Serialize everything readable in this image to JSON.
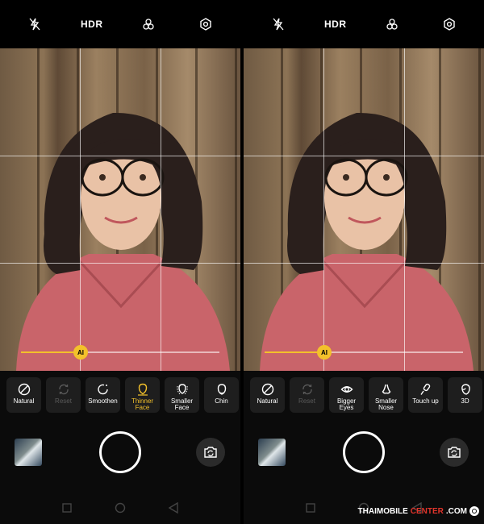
{
  "colors": {
    "accent": "#f3c12b",
    "watermark_accent": "#e0342b"
  },
  "topbar": {
    "hdr_label": "HDR",
    "icons": [
      "flash-off-icon",
      "filter-icon",
      "settings-icon"
    ]
  },
  "slider": {
    "badge": "AI",
    "level": 0.3
  },
  "left_panel": {
    "tools": [
      {
        "label": "Natural",
        "icon": "natural-icon",
        "state": "normal"
      },
      {
        "label": "Reset",
        "icon": "reset-icon",
        "state": "disabled"
      },
      {
        "label": "Smoothen",
        "icon": "smoothen-icon",
        "state": "normal"
      },
      {
        "label": "Thinner\nFace",
        "icon": "thinner-face-icon",
        "state": "active"
      },
      {
        "label": "Smaller\nFace",
        "icon": "smaller-face-icon",
        "state": "normal"
      },
      {
        "label": "Chin",
        "icon": "chin-icon",
        "state": "normal"
      }
    ]
  },
  "right_panel": {
    "tools": [
      {
        "label": "Natural",
        "icon": "natural-icon",
        "state": "normal"
      },
      {
        "label": "Reset",
        "icon": "reset-icon",
        "state": "disabled"
      },
      {
        "label": "Bigger\nEyes",
        "icon": "eye-icon",
        "state": "normal"
      },
      {
        "label": "Smaller\nNose",
        "icon": "nose-icon",
        "state": "normal"
      },
      {
        "label": "Touch up",
        "icon": "touch-up-icon",
        "state": "normal"
      },
      {
        "label": "3D",
        "icon": "3d-icon",
        "state": "normal"
      }
    ]
  },
  "watermark": {
    "part1": "THAIMOBILE",
    "part2": "CENTER",
    "part3": ".COM"
  }
}
